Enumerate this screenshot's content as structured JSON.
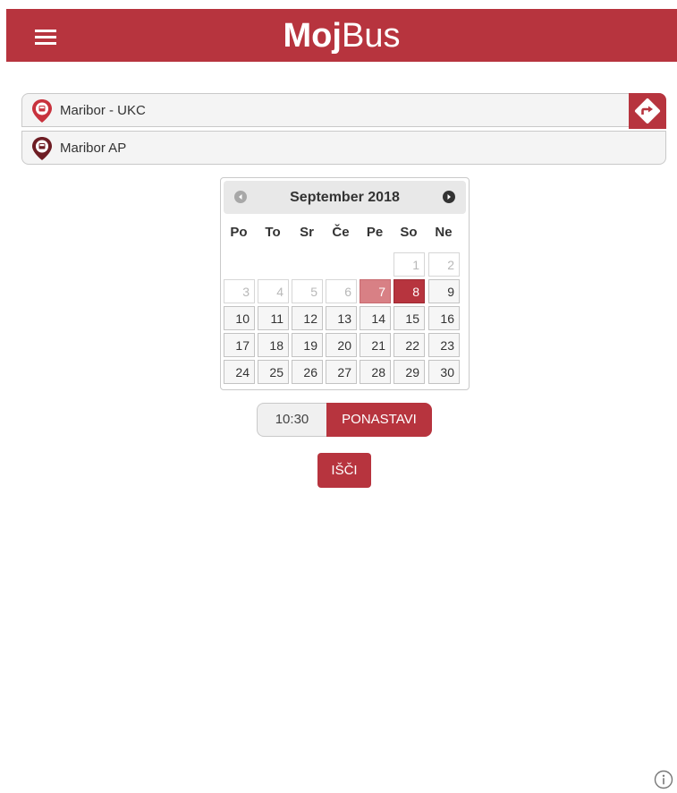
{
  "header": {
    "logo_bold": "Moj",
    "logo_regular": "Bus",
    "background_color": "#b7343e",
    "menu_icon": "hamburger-menu-icon"
  },
  "route": {
    "from": "Maribor - UKC",
    "to": "Maribor AP",
    "from_icon": "bus-stop-pin-icon",
    "to_icon": "bus-stop-pin-icon",
    "swap_icon": "directions-icon"
  },
  "calendar": {
    "title": "September 2018",
    "prev_icon": "prev-month-icon",
    "next_icon": "next-month-icon",
    "weekdays": [
      "Po",
      "To",
      "Sr",
      "Če",
      "Pe",
      "So",
      "Ne"
    ],
    "weeks": [
      [
        null,
        null,
        null,
        null,
        null,
        "1",
        "2"
      ],
      [
        "3",
        "4",
        "5",
        "6",
        "7",
        "8",
        "9"
      ],
      [
        "10",
        "11",
        "12",
        "13",
        "14",
        "15",
        "16"
      ],
      [
        "17",
        "18",
        "19",
        "20",
        "21",
        "22",
        "23"
      ],
      [
        "24",
        "25",
        "26",
        "27",
        "28",
        "29",
        "30"
      ]
    ],
    "disabled_days": [
      "1",
      "2",
      "3",
      "4",
      "5",
      "6"
    ],
    "today": "7",
    "selected": "8"
  },
  "time": {
    "value": "10:30",
    "reset_label": "PONASTAVI"
  },
  "search": {
    "label": "IŠČI"
  },
  "footer": {
    "info_icon": "info-icon"
  }
}
